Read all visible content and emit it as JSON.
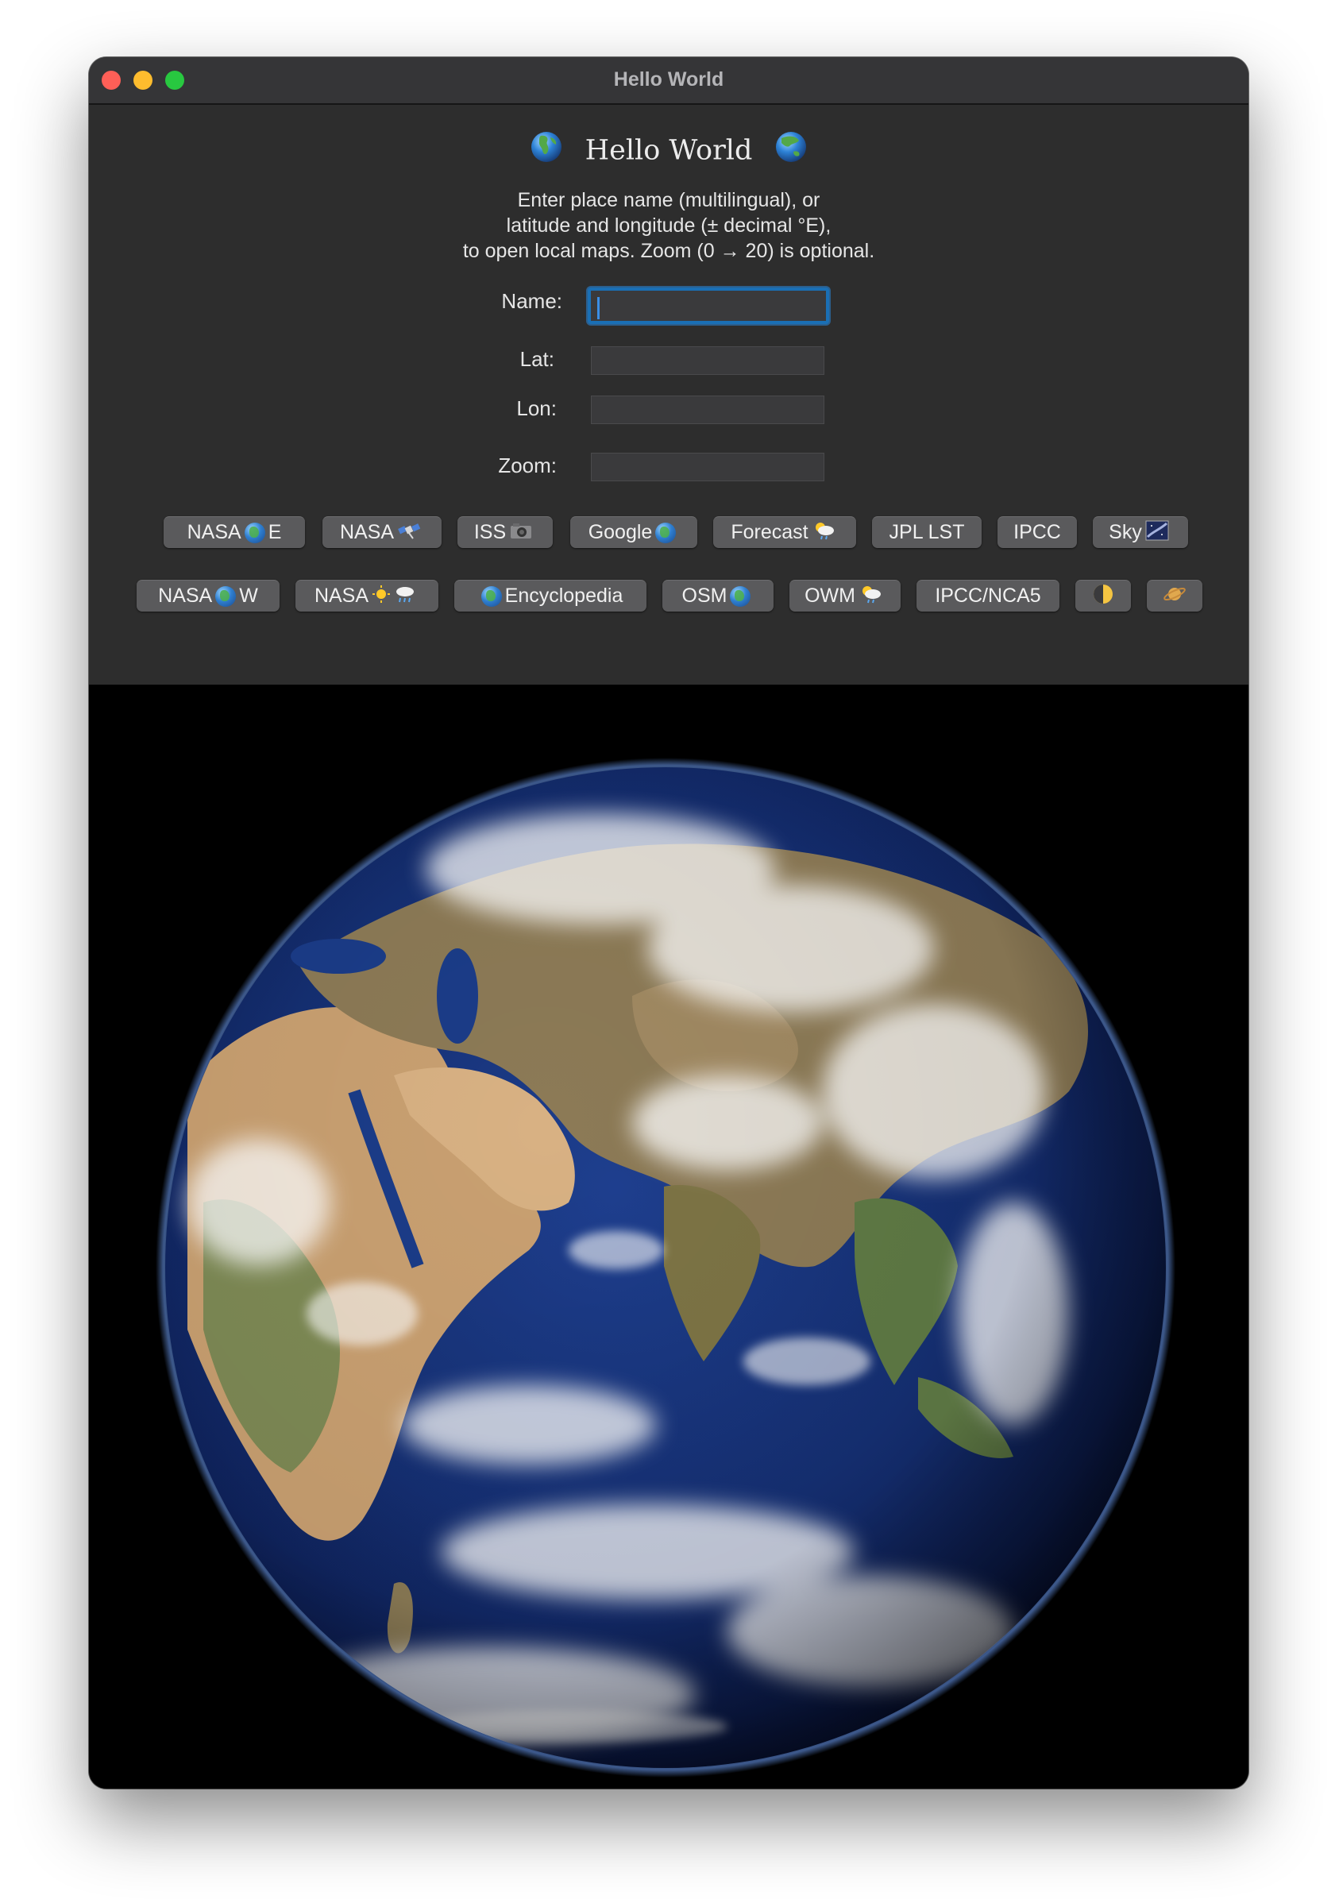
{
  "window": {
    "title": "Hello World"
  },
  "header": {
    "title": "Hello World",
    "globe_left_icon": "globe-europe-africa-icon",
    "globe_right_icon": "globe-asia-australia-icon"
  },
  "instructions": [
    "Enter place name (multilingual), or",
    "latitude and longitude (± decimal °E),",
    "to open local maps. Zoom (0 → 20) is optional."
  ],
  "form": {
    "name_label": "Name:",
    "lat_label": "Lat:",
    "lon_label": "Lon:",
    "zoom_label": "Zoom:",
    "name_value": "",
    "lat_value": "",
    "lon_value": "",
    "zoom_value": ""
  },
  "buttons_row1": [
    {
      "label": "NASA",
      "icon": "globe-icon",
      "suffix": "E"
    },
    {
      "label": "NASA",
      "icon": "satellite-icon",
      "suffix": ""
    },
    {
      "label": "ISS",
      "icon": "camera-icon",
      "suffix": ""
    },
    {
      "label": "Google",
      "icon": "globe-icon",
      "suffix": ""
    },
    {
      "label": "Forecast",
      "icon": "sun-behind-rain-icon",
      "suffix": ""
    },
    {
      "label": "JPL LST",
      "icon": "",
      "suffix": ""
    },
    {
      "label": "IPCC",
      "icon": "",
      "suffix": ""
    },
    {
      "label": "Sky",
      "icon": "milky-way-icon",
      "suffix": ""
    }
  ],
  "buttons_row2": [
    {
      "label": "NASA",
      "icon": "globe-americas-icon",
      "suffix": "W"
    },
    {
      "label": "NASA",
      "icon": "sun-and-rain-icon",
      "suffix": ""
    },
    {
      "label": "Encyclopedia",
      "icon": "globe-icon",
      "suffix": ""
    },
    {
      "label": "OSM",
      "icon": "globe-icon",
      "suffix": ""
    },
    {
      "label": "OWM",
      "icon": "sun-behind-rain-icon",
      "suffix": ""
    },
    {
      "label": "IPCC/NCA5",
      "icon": "",
      "suffix": ""
    },
    {
      "label": "",
      "icon": "moon-icon",
      "suffix": ""
    },
    {
      "label": "",
      "icon": "ringed-planet-icon",
      "suffix": ""
    }
  ],
  "colors": {
    "window_bg": "#2d2d2d",
    "titlebar": "#353537",
    "button_bg": "#5a5a5c",
    "focus_ring": "#1a6fb5",
    "close": "#ff5f57",
    "minimize": "#febc2e",
    "zoom": "#28c840"
  },
  "image": {
    "subject": "earth-globe-image"
  }
}
